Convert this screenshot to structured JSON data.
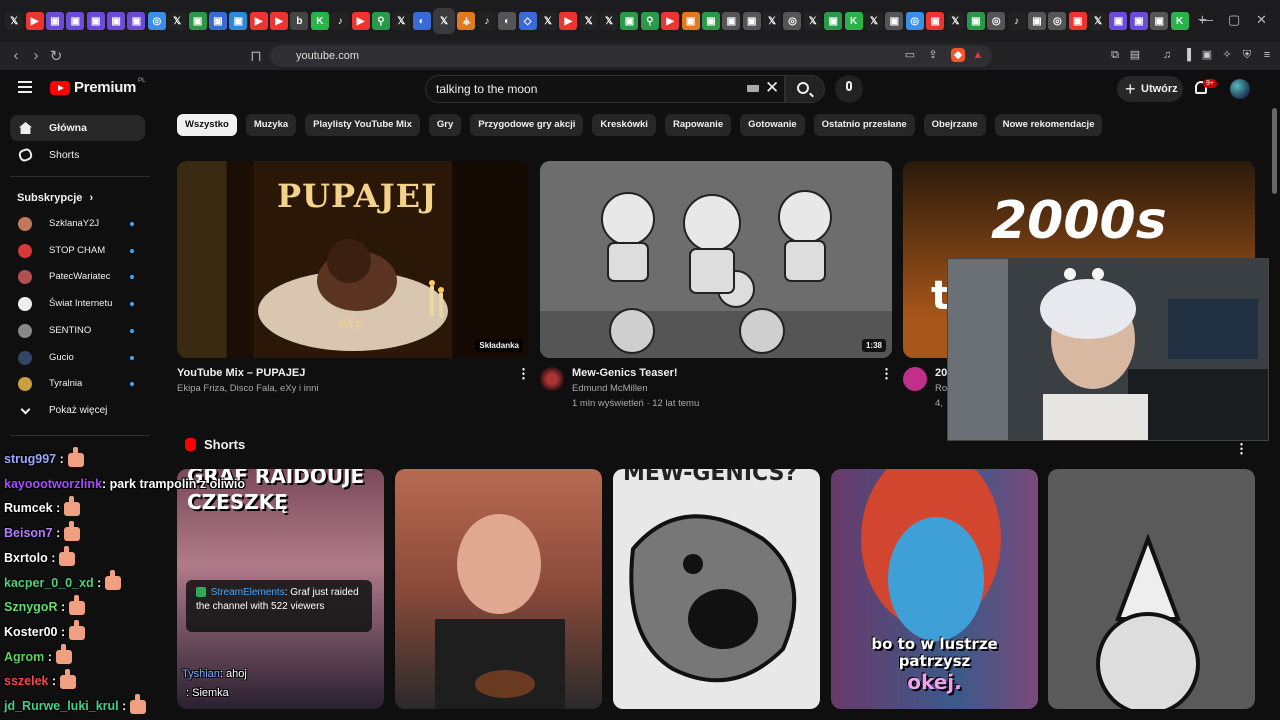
{
  "browser": {
    "url": "youtube.com",
    "tab_glyphs": [
      "𝕏",
      "▶",
      "▣",
      "▣",
      "▣",
      "▣",
      "▣",
      "◎",
      "𝕏",
      "▣",
      "▣",
      "▣",
      "▶",
      "▶",
      "b",
      "K",
      "♪",
      "▶",
      "⚲",
      "𝕏",
      "◐",
      "𝕏",
      "⚶",
      "♪",
      "◐",
      "◇",
      "𝕏",
      "▶",
      "𝕏",
      "𝕏",
      "▣",
      "⚲",
      "▶",
      "▣",
      "▣",
      "▣",
      "▣",
      "𝕏",
      "◎",
      "𝕏",
      "▣",
      "K",
      "𝕏",
      "▣",
      "◎",
      "▣",
      "𝕏",
      "▣",
      "◎",
      "♪",
      "▣",
      "◎",
      "▣",
      "𝕏",
      "▣",
      "▣",
      "▣",
      "K"
    ]
  },
  "header": {
    "logo_text": "Premium",
    "logo_country": "PL",
    "search_query": "talking to the moon",
    "create_label": "Utwórz",
    "notif_badge": "9+"
  },
  "sidebar": {
    "home": "Główna",
    "shorts": "Shorts",
    "subs_title": "Subskrypcje",
    "subs_chevron": "›",
    "subscriptions": [
      {
        "name": "SzklanaY2J",
        "color": "#c0785a"
      },
      {
        "name": "STOP CHAM",
        "color": "#d43a3a"
      },
      {
        "name": "PatecWariatec",
        "color": "#b05050"
      },
      {
        "name": "Świat Internetu",
        "color": "#eeeeee"
      },
      {
        "name": "SENTINO",
        "color": "#888888"
      },
      {
        "name": "Gucio",
        "color": "#334466"
      },
      {
        "name": "Tyralnia",
        "color": "#c8a040"
      }
    ],
    "show_more": "Pokaż więcej"
  },
  "chips": [
    "Wszystko",
    "Muzyka",
    "Playlisty YouTube Mix",
    "Gry",
    "Przygodowe gry akcji",
    "Kreskówki",
    "Rapowanie",
    "Gotowanie",
    "Ostatnio przesłane",
    "Obejrzane",
    "Nowe rekomendacje"
  ],
  "videos": [
    {
      "title": "YouTube Mix – PUPAJEJ",
      "channel": "Ekipa Friza, Disco Fala, eXy i inni",
      "stats": "",
      "badge": "Składanka",
      "thumb_text": "PUPAJEJ",
      "thumb_sub": "eXy"
    },
    {
      "title": "Mew-Genics Teaser!",
      "channel": "Edmund McMillen",
      "stats": "1 mln wyświetleń · 12 lat temu",
      "badge": "1:38",
      "thumb_text": "",
      "thumb_sub": ""
    },
    {
      "title": "20",
      "channel": "Ro",
      "stats": "4,",
      "badge": "",
      "thumb_text": "2000s",
      "thumb_sub": "t"
    }
  ],
  "shorts": {
    "title": "Shorts",
    "items": [
      {
        "caption": "GRAF RAIDOUJE CZESZKĘ"
      },
      {
        "caption": ""
      },
      {
        "caption": "MEW-GENICS?"
      },
      {
        "caption_line1": "bo to w lustrze",
        "caption_line2": "patrzysz",
        "caption_line3": "okej."
      },
      {
        "caption": ""
      }
    ]
  },
  "chat": [
    {
      "user": "strug997",
      "color": "#9aa8ff",
      "msg": "",
      "emote": true
    },
    {
      "user": "kayoootworzlink",
      "color": "#a64dff",
      "msg": ": park trampolin z oliwio",
      "emote": false
    },
    {
      "user": "Rumcek",
      "color": "#ffffff",
      "msg": "",
      "emote": true
    },
    {
      "user": "Beison7",
      "color": "#b57cff",
      "msg": "",
      "emote": true
    },
    {
      "user": "Bxrtolo",
      "color": "#ffffff",
      "msg": "",
      "emote": true
    },
    {
      "user": "kacper_0_0_xd",
      "color": "#4fd17a",
      "msg": "",
      "emote": true
    },
    {
      "user": "SznygoR",
      "color": "#63e06b",
      "msg": "",
      "emote": true
    },
    {
      "user": "Koster00",
      "color": "#ffffff",
      "msg": "",
      "emote": true
    },
    {
      "user": "Agrom",
      "color": "#5ad35a",
      "msg": "",
      "emote": true
    },
    {
      "user": "sszelek",
      "color": "#ff4444",
      "msg": "",
      "emote": true
    },
    {
      "user": "jd_Rurwe_luki_krul",
      "color": "#3fd18a",
      "msg": "",
      "emote": true
    }
  ],
  "stream_elements": {
    "name": "StreamElements",
    "text": ": Graf just raided the channel with 522 viewers"
  },
  "chat_extra": [
    {
      "user": "Tyshian",
      "msg": ": ahoj",
      "color": "#7ab0ff"
    },
    {
      "user": "",
      "msg": ": Siemka",
      "color": "#4460ff"
    }
  ]
}
